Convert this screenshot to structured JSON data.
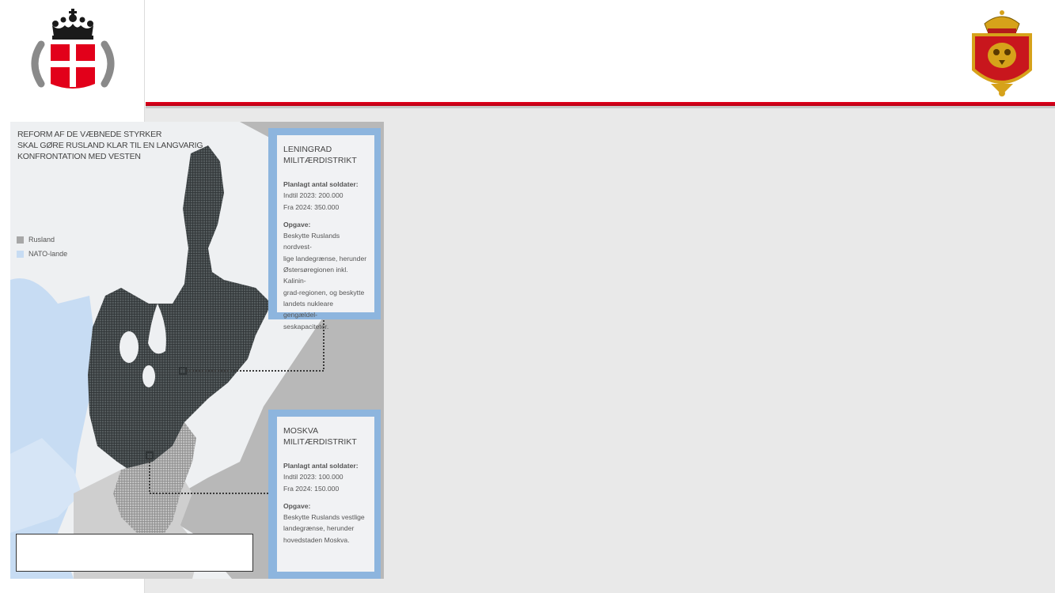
{
  "map": {
    "title_lines": [
      "REFORM AF DE VÆBNEDE STYRKER",
      "SKAL GØRE RUSLAND KLAR TIL EN LANGVARIG",
      "KONFRONTATION MED VESTEN"
    ],
    "legend": [
      {
        "label": "Rusland",
        "color": "#a7a7a7"
      },
      {
        "label": "NATO-lande",
        "color": "#c7dcf3"
      }
    ]
  },
  "districts": [
    {
      "title_lines": [
        "LENINGRAD",
        "MILITÆRDISTRIKT"
      ],
      "soldiers_heading": "Planlagt antal soldater:",
      "soldiers_lines": [
        "Indtil 2023: 200.000",
        "Fra 2024: 350.000"
      ],
      "task_heading": "Opgave:",
      "task_lines": [
        "Beskytte Ruslands nordvest-",
        "lige landegrænse, herunder",
        "Østersøregionen inkl. Kalinin-",
        "grad-regionen, og beskytte",
        "landets nukleare gengældel-",
        "seskapaciteter."
      ]
    },
    {
      "title_lines": [
        "MOSKVA",
        "MILITÆRDISTRIKT"
      ],
      "soldiers_heading": "Planlagt antal soldater:",
      "soldiers_lines": [
        "Indtil 2023: 100.000",
        "Fra 2024: 150.000"
      ],
      "task_heading": "Opgave:",
      "task_lines": [
        "Beskytte Ruslands vestlige",
        "landegrænse, herunder",
        "hovedstaden Moskva."
      ]
    }
  ],
  "caption": {
    "text": ""
  },
  "colors": {
    "accent_red": "#e2001a",
    "district_frame": "#8db5de",
    "russia_dark": "#4a5052",
    "nato_blue": "#c7dcf3"
  }
}
